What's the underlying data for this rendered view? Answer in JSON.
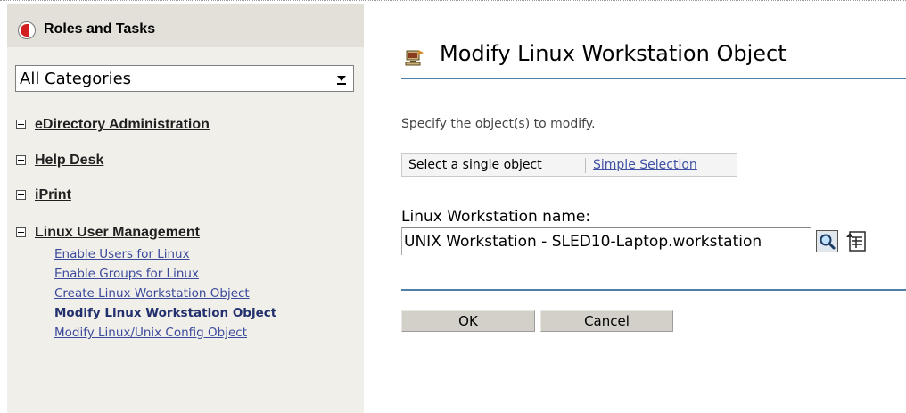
{
  "sidebar": {
    "header_title": "Roles and Tasks",
    "header_icon": "roles-and-tasks-icon",
    "category_select": {
      "value": "All Categories"
    },
    "groups": [
      {
        "label": "eDirectory Administration",
        "expanded": false
      },
      {
        "label": "Help Desk",
        "expanded": false
      },
      {
        "label": "iPrint",
        "expanded": false
      },
      {
        "label": "Linux User Management",
        "expanded": true,
        "items": [
          {
            "label": "Enable Users for Linux",
            "active": false
          },
          {
            "label": "Enable Groups for Linux",
            "active": false
          },
          {
            "label": "Create Linux Workstation Object",
            "active": false
          },
          {
            "label": "Modify Linux Workstation Object",
            "active": true
          },
          {
            "label": "Modify Linux/Unix Config Object",
            "active": false
          }
        ]
      }
    ]
  },
  "main": {
    "title": "Modify Linux Workstation Object",
    "title_icon": "workstation-object-icon",
    "instruction": "Specify the object(s) to modify.",
    "selection": {
      "single_label": "Select a single object",
      "simple_link": "Simple Selection"
    },
    "field": {
      "label": "Linux Workstation name:",
      "value": "UNIX Workstation - SLED10-Laptop.workstation"
    },
    "buttons": {
      "ok": "OK",
      "cancel": "Cancel"
    }
  },
  "colors": {
    "sidebar_bg": "#f1efea",
    "sidebar_header_bg": "#e3e0d9",
    "link": "#3b4a9c",
    "rule": "#4f7fa7",
    "button_bg": "#d3d0ca"
  }
}
